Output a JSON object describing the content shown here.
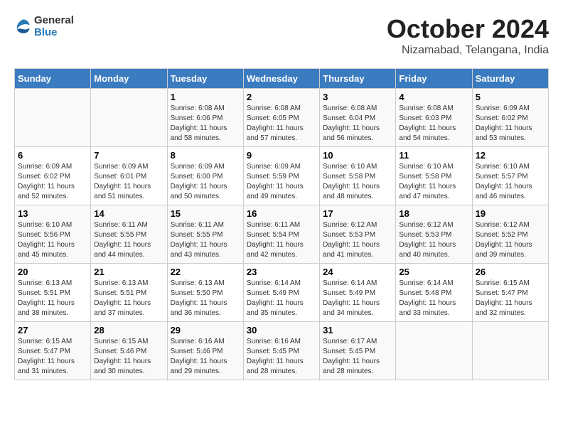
{
  "logo": {
    "general": "General",
    "blue": "Blue"
  },
  "header": {
    "month": "October 2024",
    "location": "Nizamabad, Telangana, India"
  },
  "weekdays": [
    "Sunday",
    "Monday",
    "Tuesday",
    "Wednesday",
    "Thursday",
    "Friday",
    "Saturday"
  ],
  "weeks": [
    [
      null,
      null,
      {
        "day": "1",
        "sunrise": "Sunrise: 6:08 AM",
        "sunset": "Sunset: 6:06 PM",
        "daylight": "Daylight: 11 hours and 58 minutes."
      },
      {
        "day": "2",
        "sunrise": "Sunrise: 6:08 AM",
        "sunset": "Sunset: 6:05 PM",
        "daylight": "Daylight: 11 hours and 57 minutes."
      },
      {
        "day": "3",
        "sunrise": "Sunrise: 6:08 AM",
        "sunset": "Sunset: 6:04 PM",
        "daylight": "Daylight: 11 hours and 56 minutes."
      },
      {
        "day": "4",
        "sunrise": "Sunrise: 6:08 AM",
        "sunset": "Sunset: 6:03 PM",
        "daylight": "Daylight: 11 hours and 54 minutes."
      },
      {
        "day": "5",
        "sunrise": "Sunrise: 6:09 AM",
        "sunset": "Sunset: 6:02 PM",
        "daylight": "Daylight: 11 hours and 53 minutes."
      }
    ],
    [
      {
        "day": "6",
        "sunrise": "Sunrise: 6:09 AM",
        "sunset": "Sunset: 6:02 PM",
        "daylight": "Daylight: 11 hours and 52 minutes."
      },
      {
        "day": "7",
        "sunrise": "Sunrise: 6:09 AM",
        "sunset": "Sunset: 6:01 PM",
        "daylight": "Daylight: 11 hours and 51 minutes."
      },
      {
        "day": "8",
        "sunrise": "Sunrise: 6:09 AM",
        "sunset": "Sunset: 6:00 PM",
        "daylight": "Daylight: 11 hours and 50 minutes."
      },
      {
        "day": "9",
        "sunrise": "Sunrise: 6:09 AM",
        "sunset": "Sunset: 5:59 PM",
        "daylight": "Daylight: 11 hours and 49 minutes."
      },
      {
        "day": "10",
        "sunrise": "Sunrise: 6:10 AM",
        "sunset": "Sunset: 5:58 PM",
        "daylight": "Daylight: 11 hours and 48 minutes."
      },
      {
        "day": "11",
        "sunrise": "Sunrise: 6:10 AM",
        "sunset": "Sunset: 5:58 PM",
        "daylight": "Daylight: 11 hours and 47 minutes."
      },
      {
        "day": "12",
        "sunrise": "Sunrise: 6:10 AM",
        "sunset": "Sunset: 5:57 PM",
        "daylight": "Daylight: 11 hours and 46 minutes."
      }
    ],
    [
      {
        "day": "13",
        "sunrise": "Sunrise: 6:10 AM",
        "sunset": "Sunset: 5:56 PM",
        "daylight": "Daylight: 11 hours and 45 minutes."
      },
      {
        "day": "14",
        "sunrise": "Sunrise: 6:11 AM",
        "sunset": "Sunset: 5:55 PM",
        "daylight": "Daylight: 11 hours and 44 minutes."
      },
      {
        "day": "15",
        "sunrise": "Sunrise: 6:11 AM",
        "sunset": "Sunset: 5:55 PM",
        "daylight": "Daylight: 11 hours and 43 minutes."
      },
      {
        "day": "16",
        "sunrise": "Sunrise: 6:11 AM",
        "sunset": "Sunset: 5:54 PM",
        "daylight": "Daylight: 11 hours and 42 minutes."
      },
      {
        "day": "17",
        "sunrise": "Sunrise: 6:12 AM",
        "sunset": "Sunset: 5:53 PM",
        "daylight": "Daylight: 11 hours and 41 minutes."
      },
      {
        "day": "18",
        "sunrise": "Sunrise: 6:12 AM",
        "sunset": "Sunset: 5:53 PM",
        "daylight": "Daylight: 11 hours and 40 minutes."
      },
      {
        "day": "19",
        "sunrise": "Sunrise: 6:12 AM",
        "sunset": "Sunset: 5:52 PM",
        "daylight": "Daylight: 11 hours and 39 minutes."
      }
    ],
    [
      {
        "day": "20",
        "sunrise": "Sunrise: 6:13 AM",
        "sunset": "Sunset: 5:51 PM",
        "daylight": "Daylight: 11 hours and 38 minutes."
      },
      {
        "day": "21",
        "sunrise": "Sunrise: 6:13 AM",
        "sunset": "Sunset: 5:51 PM",
        "daylight": "Daylight: 11 hours and 37 minutes."
      },
      {
        "day": "22",
        "sunrise": "Sunrise: 6:13 AM",
        "sunset": "Sunset: 5:50 PM",
        "daylight": "Daylight: 11 hours and 36 minutes."
      },
      {
        "day": "23",
        "sunrise": "Sunrise: 6:14 AM",
        "sunset": "Sunset: 5:49 PM",
        "daylight": "Daylight: 11 hours and 35 minutes."
      },
      {
        "day": "24",
        "sunrise": "Sunrise: 6:14 AM",
        "sunset": "Sunset: 5:49 PM",
        "daylight": "Daylight: 11 hours and 34 minutes."
      },
      {
        "day": "25",
        "sunrise": "Sunrise: 6:14 AM",
        "sunset": "Sunset: 5:48 PM",
        "daylight": "Daylight: 11 hours and 33 minutes."
      },
      {
        "day": "26",
        "sunrise": "Sunrise: 6:15 AM",
        "sunset": "Sunset: 5:47 PM",
        "daylight": "Daylight: 11 hours and 32 minutes."
      }
    ],
    [
      {
        "day": "27",
        "sunrise": "Sunrise: 6:15 AM",
        "sunset": "Sunset: 5:47 PM",
        "daylight": "Daylight: 11 hours and 31 minutes."
      },
      {
        "day": "28",
        "sunrise": "Sunrise: 6:15 AM",
        "sunset": "Sunset: 5:46 PM",
        "daylight": "Daylight: 11 hours and 30 minutes."
      },
      {
        "day": "29",
        "sunrise": "Sunrise: 6:16 AM",
        "sunset": "Sunset: 5:46 PM",
        "daylight": "Daylight: 11 hours and 29 minutes."
      },
      {
        "day": "30",
        "sunrise": "Sunrise: 6:16 AM",
        "sunset": "Sunset: 5:45 PM",
        "daylight": "Daylight: 11 hours and 28 minutes."
      },
      {
        "day": "31",
        "sunrise": "Sunrise: 6:17 AM",
        "sunset": "Sunset: 5:45 PM",
        "daylight": "Daylight: 11 hours and 28 minutes."
      },
      null,
      null
    ]
  ]
}
